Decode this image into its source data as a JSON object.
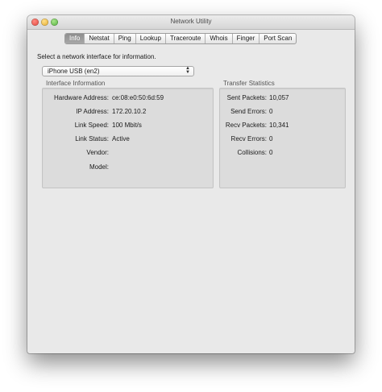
{
  "window": {
    "title": "Network Utility"
  },
  "tabs": [
    "Info",
    "Netstat",
    "Ping",
    "Lookup",
    "Traceroute",
    "Whois",
    "Finger",
    "Port Scan"
  ],
  "selected_tab": "Info",
  "prompt": "Select a network interface for information.",
  "interface_select": {
    "value": "iPhone USB (en2)"
  },
  "interface_info": {
    "heading": "Interface Information",
    "rows": [
      {
        "label": "Hardware Address:",
        "value": "ce:08:e0:50:6d:59"
      },
      {
        "label": "IP Address:",
        "value": "172.20.10.2"
      },
      {
        "label": "Link Speed:",
        "value": "100 Mbit/s"
      },
      {
        "label": "Link Status:",
        "value": "Active"
      },
      {
        "label": "Vendor:",
        "value": ""
      },
      {
        "label": "Model:",
        "value": ""
      }
    ]
  },
  "transfer_stats": {
    "heading": "Transfer Statistics",
    "rows": [
      {
        "label": "Sent Packets:",
        "value": "10,057"
      },
      {
        "label": "Send Errors:",
        "value": "0"
      },
      {
        "label": "Recv Packets:",
        "value": "10,341"
      },
      {
        "label": "Recv Errors:",
        "value": "0"
      },
      {
        "label": "Collisions:",
        "value": "0"
      }
    ]
  }
}
